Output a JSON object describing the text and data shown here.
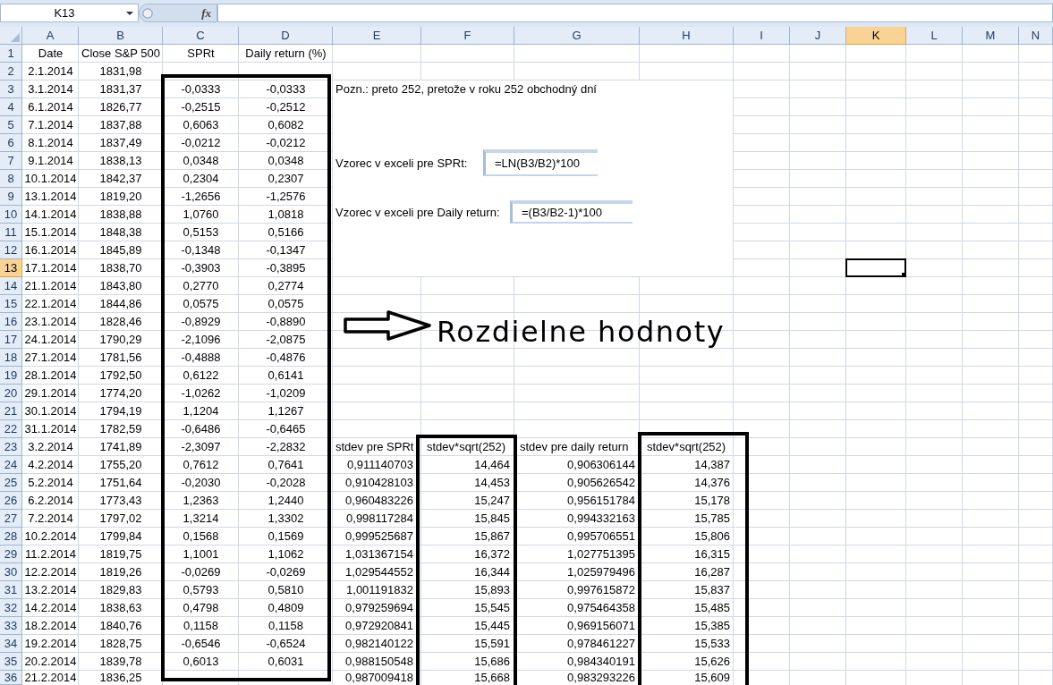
{
  "name_box": {
    "value": "K13"
  },
  "formula_bar": {
    "function_label": "fx"
  },
  "columns": [
    {
      "label": "A",
      "selected": false
    },
    {
      "label": "B",
      "selected": false
    },
    {
      "label": "C",
      "selected": false
    },
    {
      "label": "D",
      "selected": false
    },
    {
      "label": "E",
      "selected": false
    },
    {
      "label": "F",
      "selected": false
    },
    {
      "label": "G",
      "selected": false
    },
    {
      "label": "H",
      "selected": false
    },
    {
      "label": "I",
      "selected": false
    },
    {
      "label": "J",
      "selected": false
    },
    {
      "label": "K",
      "selected": true
    },
    {
      "label": "L",
      "selected": false
    },
    {
      "label": "M",
      "selected": false
    },
    {
      "label": "N",
      "selected": false
    }
  ],
  "row_headers": [
    {
      "label": "1",
      "selected": false
    },
    {
      "label": "2",
      "selected": false
    },
    {
      "label": "3",
      "selected": false
    },
    {
      "label": "4",
      "selected": false
    },
    {
      "label": "5",
      "selected": false
    },
    {
      "label": "6",
      "selected": false
    },
    {
      "label": "7",
      "selected": false
    },
    {
      "label": "8",
      "selected": false
    },
    {
      "label": "9",
      "selected": false
    },
    {
      "label": "10",
      "selected": false
    },
    {
      "label": "11",
      "selected": false
    },
    {
      "label": "12",
      "selected": false
    },
    {
      "label": "13",
      "selected": true
    },
    {
      "label": "14",
      "selected": false
    },
    {
      "label": "15",
      "selected": false
    },
    {
      "label": "16",
      "selected": false
    },
    {
      "label": "17",
      "selected": false
    },
    {
      "label": "18",
      "selected": false
    },
    {
      "label": "19",
      "selected": false
    },
    {
      "label": "20",
      "selected": false
    },
    {
      "label": "21",
      "selected": false
    },
    {
      "label": "22",
      "selected": false
    },
    {
      "label": "23",
      "selected": false
    },
    {
      "label": "24",
      "selected": false
    },
    {
      "label": "25",
      "selected": false
    },
    {
      "label": "26",
      "selected": false
    },
    {
      "label": "27",
      "selected": false
    },
    {
      "label": "28",
      "selected": false
    },
    {
      "label": "29",
      "selected": false
    },
    {
      "label": "30",
      "selected": false
    },
    {
      "label": "31",
      "selected": false
    },
    {
      "label": "32",
      "selected": false
    },
    {
      "label": "33",
      "selected": false
    },
    {
      "label": "34",
      "selected": false
    },
    {
      "label": "35",
      "selected": false
    },
    {
      "label": "36",
      "selected": false
    }
  ],
  "data_table": {
    "header": [
      "Date",
      "Close S&P 500",
      "SPRt",
      "Daily return (%)"
    ],
    "rows": [
      {
        "date": "2.1.2014",
        "close": "1831,98"
      },
      {
        "date": "3.1.2014",
        "close": "1831,37",
        "sprt": "-0,0333",
        "daily_return": "-0,0333"
      },
      {
        "date": "6.1.2014",
        "close": "1826,77",
        "sprt": "-0,2515",
        "daily_return": "-0,2512"
      },
      {
        "date": "7.1.2014",
        "close": "1837,88",
        "sprt": "0,6063",
        "daily_return": "0,6082"
      },
      {
        "date": "8.1.2014",
        "close": "1837,49",
        "sprt": "-0,0212",
        "daily_return": "-0,0212"
      },
      {
        "date": "9.1.2014",
        "close": "1838,13",
        "sprt": "0,0348",
        "daily_return": "0,0348"
      },
      {
        "date": "10.1.2014",
        "close": "1842,37",
        "sprt": "0,2304",
        "daily_return": "0,2307"
      },
      {
        "date": "13.1.2014",
        "close": "1819,20",
        "sprt": "-1,2656",
        "daily_return": "-1,2576"
      },
      {
        "date": "14.1.2014",
        "close": "1838,88",
        "sprt": "1,0760",
        "daily_return": "1,0818"
      },
      {
        "date": "15.1.2014",
        "close": "1848,38",
        "sprt": "0,5153",
        "daily_return": "0,5166"
      },
      {
        "date": "16.1.2014",
        "close": "1845,89",
        "sprt": "-0,1348",
        "daily_return": "-0,1347"
      },
      {
        "date": "17.1.2014",
        "close": "1838,70",
        "sprt": "-0,3903",
        "daily_return": "-0,3895"
      },
      {
        "date": "21.1.2014",
        "close": "1843,80",
        "sprt": "0,2770",
        "daily_return": "0,2774"
      },
      {
        "date": "22.1.2014",
        "close": "1844,86",
        "sprt": "0,0575",
        "daily_return": "0,0575"
      },
      {
        "date": "23.1.2014",
        "close": "1828,46",
        "sprt": "-0,8929",
        "daily_return": "-0,8890"
      },
      {
        "date": "24.1.2014",
        "close": "1790,29",
        "sprt": "-2,1096",
        "daily_return": "-2,0875"
      },
      {
        "date": "27.1.2014",
        "close": "1781,56",
        "sprt": "-0,4888",
        "daily_return": "-0,4876"
      },
      {
        "date": "28.1.2014",
        "close": "1792,50",
        "sprt": "0,6122",
        "daily_return": "0,6141"
      },
      {
        "date": "29.1.2014",
        "close": "1774,20",
        "sprt": "-1,0262",
        "daily_return": "-1,0209"
      },
      {
        "date": "30.1.2014",
        "close": "1794,19",
        "sprt": "1,1204",
        "daily_return": "1,1267"
      },
      {
        "date": "31.1.2014",
        "close": "1782,59",
        "sprt": "-0,6486",
        "daily_return": "-0,6465"
      },
      {
        "date": "3.2.2014",
        "close": "1741,89",
        "sprt": "-2,3097",
        "daily_return": "-2,2832"
      },
      {
        "date": "4.2.2014",
        "close": "1755,20",
        "sprt": "0,7612",
        "daily_return": "0,7641"
      },
      {
        "date": "5.2.2014",
        "close": "1751,64",
        "sprt": "-0,2030",
        "daily_return": "-0,2028"
      },
      {
        "date": "6.2.2014",
        "close": "1773,43",
        "sprt": "1,2363",
        "daily_return": "1,2440"
      },
      {
        "date": "7.2.2014",
        "close": "1797,02",
        "sprt": "1,3214",
        "daily_return": "1,3302"
      },
      {
        "date": "10.2.2014",
        "close": "1799,84",
        "sprt": "0,1568",
        "daily_return": "0,1569"
      },
      {
        "date": "11.2.2014",
        "close": "1819,75",
        "sprt": "1,1001",
        "daily_return": "1,1062"
      },
      {
        "date": "12.2.2014",
        "close": "1819,26",
        "sprt": "-0,0269",
        "daily_return": "-0,0269"
      },
      {
        "date": "13.2.2014",
        "close": "1829,83",
        "sprt": "0,5793",
        "daily_return": "0,5810"
      },
      {
        "date": "14.2.2014",
        "close": "1838,63",
        "sprt": "0,4798",
        "daily_return": "0,4809"
      },
      {
        "date": "18.2.2014",
        "close": "1840,76",
        "sprt": "0,1158",
        "daily_return": "0,1158"
      },
      {
        "date": "19.2.2014",
        "close": "1828,75",
        "sprt": "-0,6546",
        "daily_return": "-0,6524"
      },
      {
        "date": "20.2.2014",
        "close": "1839,78",
        "sprt": "0,6013",
        "daily_return": "0,6031"
      },
      {
        "date": "21.2.2014",
        "close": "1836,25"
      }
    ]
  },
  "notes": {
    "remark": "Pozn.: preto 252, pretože v roku 252 obchodný dní",
    "formulas": [
      {
        "label": "Vzorec v exceli pre SPRt:",
        "formula": "=LN(B3/B2)*100"
      },
      {
        "label": "Vzorec v exceli pre Daily return:",
        "formula": "=(B3/B2-1)*100"
      }
    ]
  },
  "annotation": {
    "text": "Rozdielne hodnoty"
  },
  "volatility_table": {
    "header": [
      "stdev pre SPRt",
      "stdev*sqrt(252)",
      "stdev pre daily return",
      "stdev*sqrt(252)"
    ],
    "rows": [
      [
        "0,911140703",
        "14,464",
        "0,906306144",
        "14,387"
      ],
      [
        "0,910428103",
        "14,453",
        "0,905626542",
        "14,376"
      ],
      [
        "0,960483226",
        "15,247",
        "0,956151784",
        "15,178"
      ],
      [
        "0,998117284",
        "15,845",
        "0,994332163",
        "15,785"
      ],
      [
        "0,999525687",
        "15,867",
        "0,995706551",
        "15,806"
      ],
      [
        "1,031367154",
        "16,372",
        "1,027751395",
        "16,315"
      ],
      [
        "1,029544552",
        "16,344",
        "1,025979496",
        "16,287"
      ],
      [
        "1,001191832",
        "15,893",
        "0,997615872",
        "15,837"
      ],
      [
        "0,979259694",
        "15,545",
        "0,975464358",
        "15,485"
      ],
      [
        "0,972920841",
        "15,445",
        "0,969156071",
        "15,385"
      ],
      [
        "0,982140122",
        "15,591",
        "0,978461227",
        "15,533"
      ],
      [
        "0,988150548",
        "15,686",
        "0,984340191",
        "15,626"
      ],
      [
        "0,987009418",
        "15,668",
        "0,983293226",
        "15,609"
      ]
    ]
  }
}
